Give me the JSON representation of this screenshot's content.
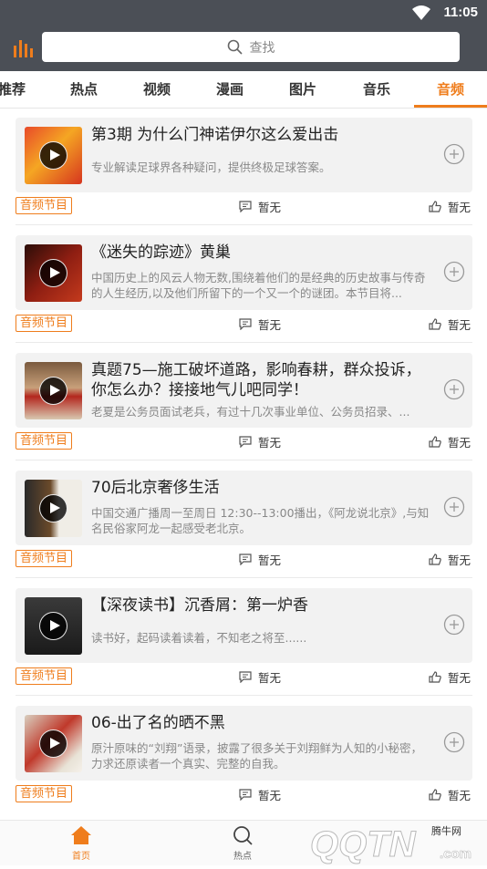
{
  "status_bar": {
    "time": "11:05"
  },
  "search": {
    "placeholder": "查找"
  },
  "tabs": [
    "推荐",
    "热点",
    "视频",
    "漫画",
    "图片",
    "音乐",
    "音频"
  ],
  "active_tab": "音频",
  "items": [
    {
      "title": "第3期 为什么门神诺伊尔这么爱出击",
      "desc": "专业解读足球界各种疑问，提供终极足球答案。",
      "badge": "音频节目",
      "comment": "暂无",
      "like": "暂无"
    },
    {
      "title": "《迷失的踪迹》黄巢",
      "desc": "中国历史上的风云人物无数,围绕着他们的是经典的历史故事与传奇的人生经历,以及他们所留下的一个又一个的谜团。本节目将...",
      "badge": "音频节目",
      "comment": "暂无",
      "like": "暂无"
    },
    {
      "title": "真题75—施工破坏道路，影响春耕，群众投诉，你怎么办？接接地气儿吧同学！",
      "desc": "老夏是公务员面试老兵，有过十几次事业单位、公务员招录、...",
      "badge": "音频节目",
      "comment": "暂无",
      "like": "暂无"
    },
    {
      "title": "70后北京奢侈生活",
      "desc": "中国交通广播周一至周日 12:30--13:00播出，《阿龙说北京》,与知名民俗家阿龙一起感受老北京。",
      "badge": "音频节目",
      "comment": "暂无",
      "like": "暂无"
    },
    {
      "title": "【深夜读书】沉香屑：第一炉香",
      "desc": "读书好，起码读着读着，不知老之将至......",
      "badge": "音频节目",
      "comment": "暂无",
      "like": "暂无"
    },
    {
      "title": "06-出了名的晒不黑",
      "desc": "原汁原味的“刘翔”语录，披露了很多关于刘翔鲜为人知的小秘密，力求还原读者一个真实、完整的自我。",
      "badge": "音频节目",
      "comment": "暂无",
      "like": "暂无"
    }
  ],
  "bottom_nav": {
    "home": "首页",
    "hot": "热点"
  },
  "watermark": {
    "brand": "QQTN",
    "domain": ".com",
    "cn": "腾牛网"
  },
  "colors": {
    "accent": "#ef7d1c",
    "header_bg": "#4b4f56",
    "card_bg": "#f2f2f2"
  }
}
